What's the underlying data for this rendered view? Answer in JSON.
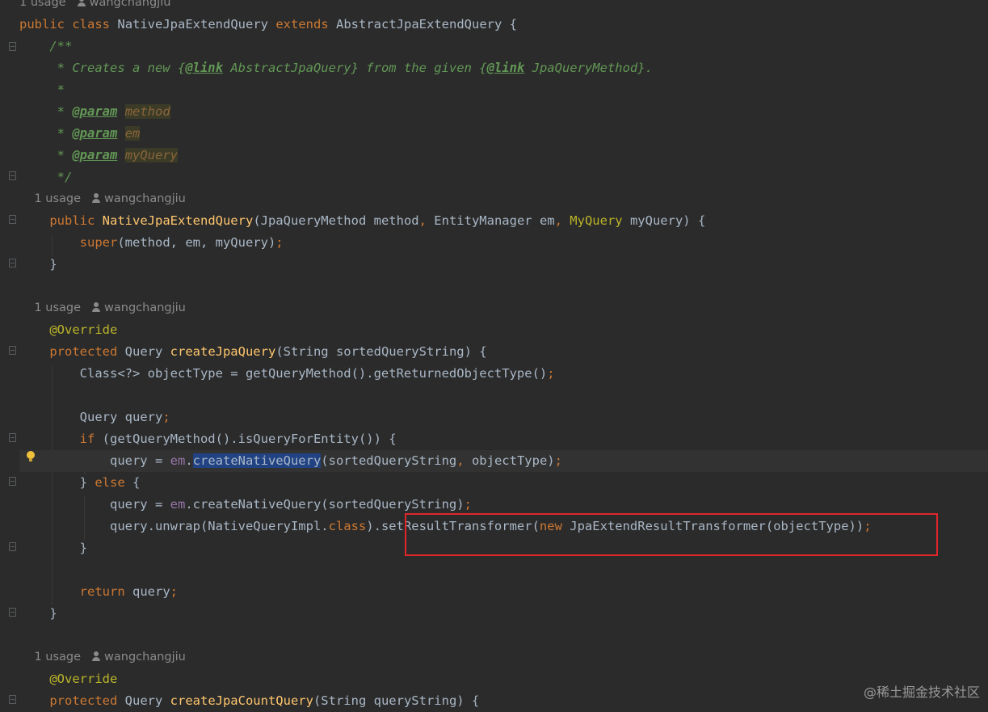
{
  "hint_class": {
    "usage": "1 usage",
    "author": "wangchangjiu"
  },
  "class_decl": {
    "kw_public": "public",
    "kw_class": "class",
    "name": "NativeJpaExtendQuery",
    "kw_extends": "extends",
    "parent": "AbstractJpaExtendQuery",
    "brace": "{"
  },
  "javadoc": {
    "open": "/**",
    "l1_pre": " * Creates a new {",
    "l1_link1": "@link",
    "l1_mid": " AbstractJpaQuery}",
    "l1_from": " from the given {",
    "l1_link2": "@link",
    "l1_end": " JpaQueryMethod}.",
    "star": " *",
    "param_tag": "@param",
    "p1": "method",
    "p2": "em",
    "p3": "myQuery",
    "close": " */"
  },
  "hint_ctor": {
    "usage": "1 usage",
    "author": "wangchangjiu"
  },
  "ctor": {
    "kw_public": "public",
    "name": "NativeJpaExtendQuery",
    "open": "(JpaQueryMethod method",
    "comma1": ",",
    "p2": " EntityManager em",
    "comma2": ",",
    "p3type": "MyQuery",
    "p3": " myQuery) {",
    "super_kw": "super",
    "super_args": "(method, em, myQuery)",
    "semi": ";",
    "close": "}"
  },
  "hint_create": {
    "usage": "1 usage",
    "author": "wangchangjiu"
  },
  "create": {
    "override": "@Override",
    "kw_protected": "protected",
    "ret": " Query ",
    "name": "createJpaQuery",
    "params": "(String sortedQueryString) {",
    "l_objtype": "Class<?> objectType = getQueryMethod().getReturnedObjectType()",
    "semi": ";",
    "l_query": "Query query",
    "kw_if": "if",
    "if_cond": " (getQueryMethod().isQueryForEntity()) {",
    "q_assign": "query = ",
    "em": "em",
    "dot": ".",
    "cnq": "createNativeQuery",
    "cnq_args1": "(sortedQueryString",
    "comma": ",",
    "cnq_args1b": " objectType)",
    "else_open": "} ",
    "kw_else": "else",
    "else_brace": " {",
    "cnq_args2": "(sortedQueryString)",
    "unwrap_pre": "query.unwrap(NativeQueryImpl.",
    "kw_class": "class",
    "unwrap_post": ").setResultTransformer(",
    "kw_new": "new",
    "transformer": " JpaExtendResultTransformer(objectType))",
    "close_inner": "}",
    "kw_return": "return",
    "ret_val": " query",
    "close": "}"
  },
  "hint_count": {
    "usage": "1 usage",
    "author": "wangchangjiu"
  },
  "count": {
    "override": "@Override",
    "kw_protected": "protected",
    "ret": " Query ",
    "name": "createJpaCountQuery",
    "params": "(String queryString) {"
  },
  "watermark": "@稀土掘金技术社区"
}
